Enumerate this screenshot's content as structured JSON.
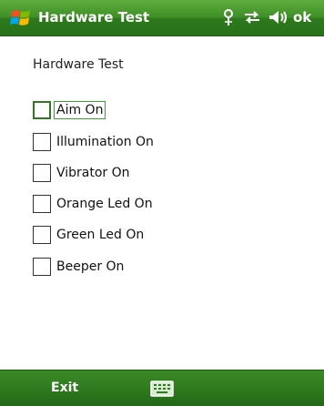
{
  "titlebar": {
    "title": "Hardware Test",
    "ok_label": "ok",
    "start_icon": "windows-start-icon",
    "status_icons": [
      "signal-icon",
      "sync-icon",
      "volume-icon"
    ]
  },
  "form": {
    "heading": "Hardware Test",
    "options": [
      {
        "label": "Aim On",
        "checked": false,
        "focused": true
      },
      {
        "label": "Illumination On",
        "checked": false,
        "focused": false
      },
      {
        "label": "Vibrator On",
        "checked": false,
        "focused": false
      },
      {
        "label": "Orange Led On",
        "checked": false,
        "focused": false
      },
      {
        "label": "Green Led On",
        "checked": false,
        "focused": false
      },
      {
        "label": "Beeper On",
        "checked": false,
        "focused": false
      }
    ]
  },
  "softkeys": {
    "left_label": "Exit",
    "keyboard_icon": "keyboard-icon"
  },
  "colors": {
    "bar_green": "#2f7a1f",
    "focus_green": "#3aa13a"
  }
}
